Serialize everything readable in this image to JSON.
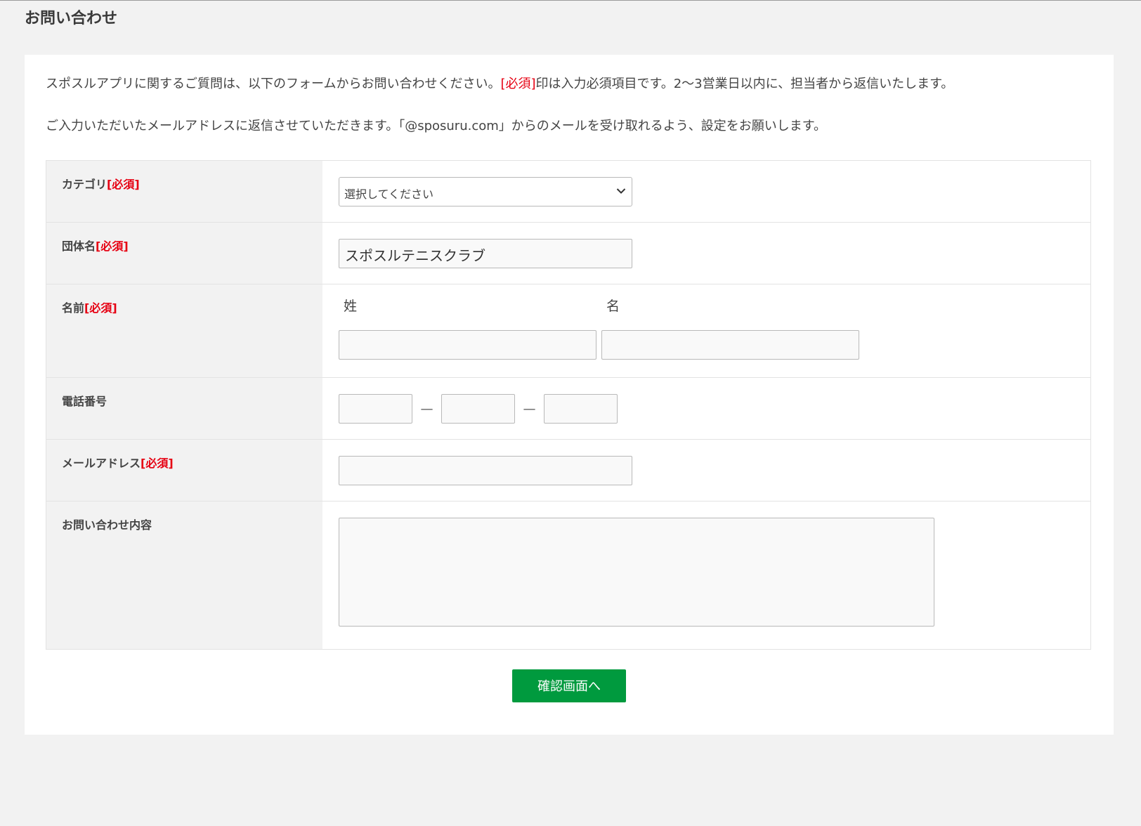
{
  "page": {
    "title": "お問い合わせ"
  },
  "intro": {
    "line1_before": "スポスルアプリに関するご質問は、以下のフォームからお問い合わせください。",
    "line1_required": "[必須]",
    "line1_after": "印は入力必須項目です。2〜3営業日以内に、担当者から返信いたします。",
    "line2": "ご入力いただいたメールアドレスに返信させていただきます。「@sposuru.com」からのメールを受け取れるよう、設定をお願いします。"
  },
  "form": {
    "required_mark": "[必須]",
    "category": {
      "label": "カテゴリ",
      "selected": "選択してください"
    },
    "group": {
      "label": "団体名",
      "value": "スポスルテニスクラブ"
    },
    "name": {
      "label": "名前",
      "last_name_label": "姓",
      "first_name_label": "名",
      "last_name_value": "",
      "first_name_value": ""
    },
    "phone": {
      "label": "電話番号",
      "separator": "—",
      "part1": "",
      "part2": "",
      "part3": ""
    },
    "email": {
      "label": "メールアドレス",
      "value": ""
    },
    "inquiry": {
      "label": "お問い合わせ内容",
      "value": ""
    }
  },
  "submit": {
    "label": "確認画面へ"
  },
  "colors": {
    "required": "#e60012",
    "submit_bg": "#009a3e",
    "label_bg": "#f2f2f2",
    "page_bg": "#f2f2f2"
  }
}
